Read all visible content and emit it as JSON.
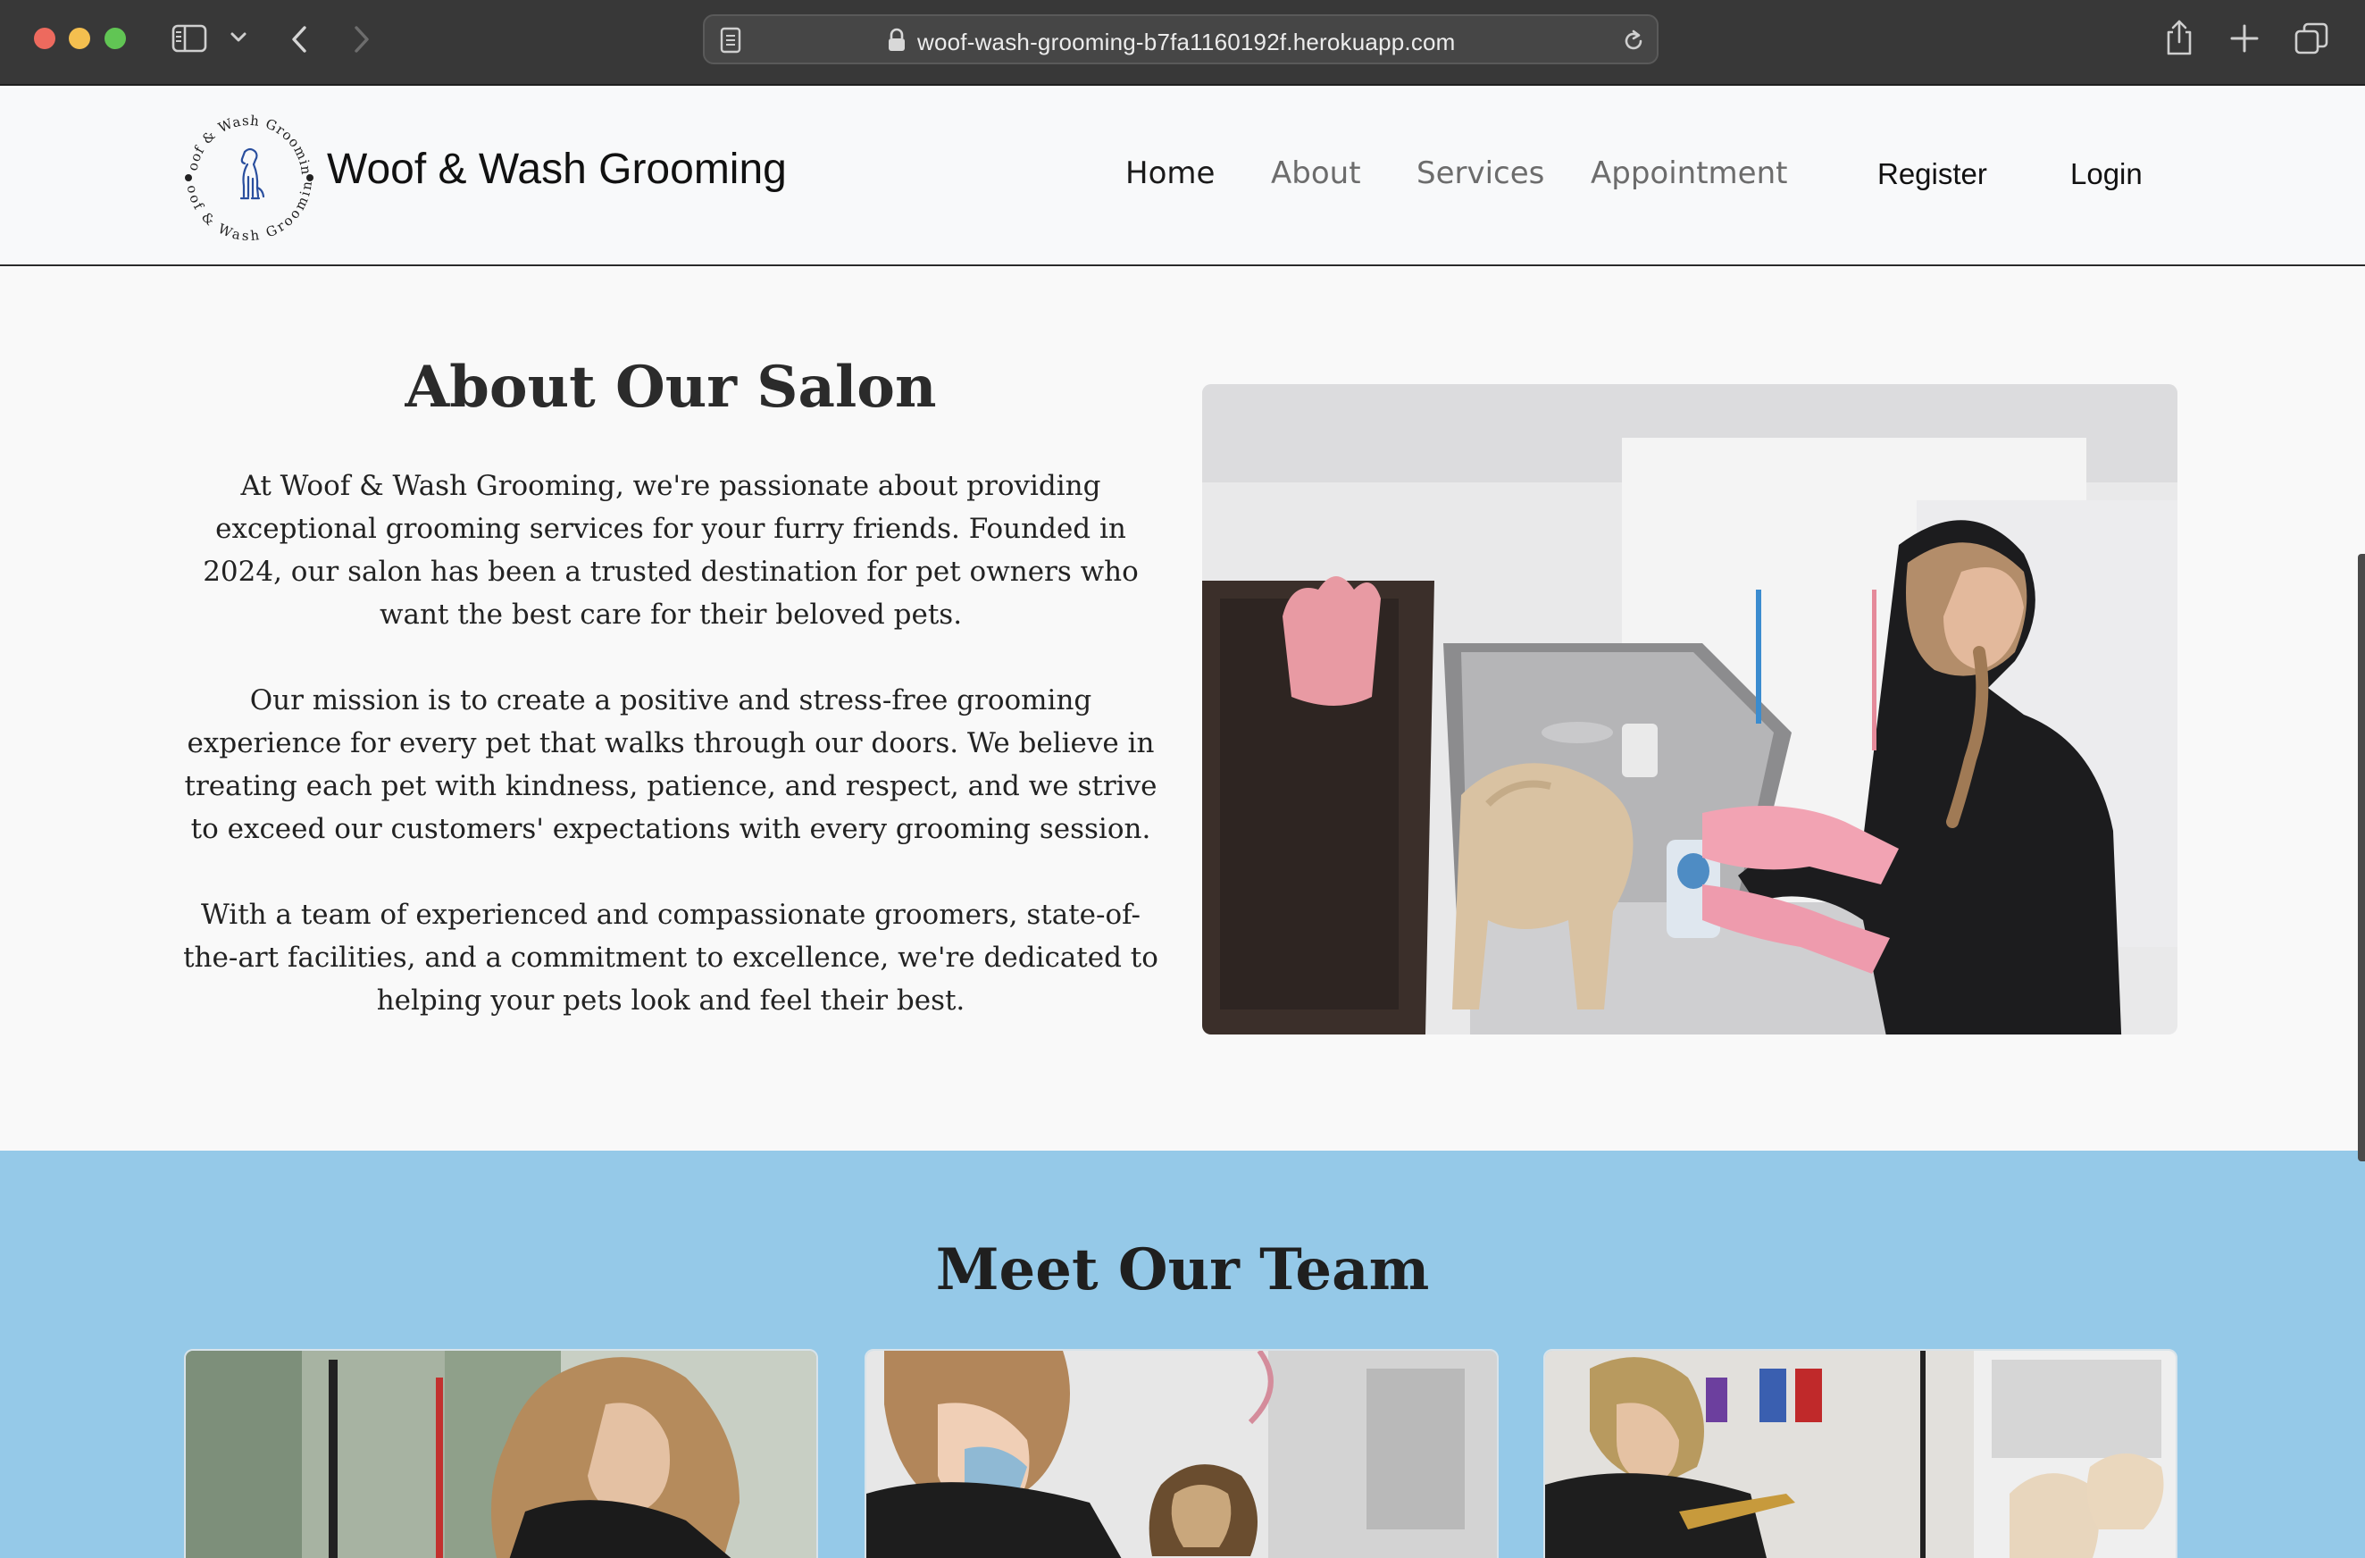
{
  "browser": {
    "url": "woof-wash-grooming-b7fa1160192f.herokuapp.com"
  },
  "header": {
    "brand": "Woof & Wash Grooming",
    "logo_ring_text": "Woof & Wash Grooming",
    "nav": [
      "Home",
      "About",
      "Services",
      "Appointment"
    ],
    "active_nav": "Home",
    "auth": [
      "Register",
      "Login"
    ]
  },
  "about": {
    "heading": "About Our Salon",
    "paragraphs": [
      "At Woof & Wash Grooming, we're passionate about providing exceptional grooming services for your furry friends. Founded in 2024, our salon has been a trusted destination for pet owners who want the best care for their beloved pets.",
      "Our mission is to create a positive and stress-free grooming experience for every pet that walks through our doors. We believe in treating each pet with kindness, patience, and respect, and we strive to exceed our customers' expectations with every grooming session.",
      "With a team of experienced and compassionate groomers, state-of-the-art facilities, and a commitment to excellence, we're dedicated to helping your pets look and feel their best."
    ]
  },
  "team": {
    "heading": "Meet Our Team"
  },
  "colors": {
    "chrome": "#383838",
    "header_bg": "#f8f9fa",
    "about_bg": "#f9f9f9",
    "team_bg": "#95c9e8"
  }
}
